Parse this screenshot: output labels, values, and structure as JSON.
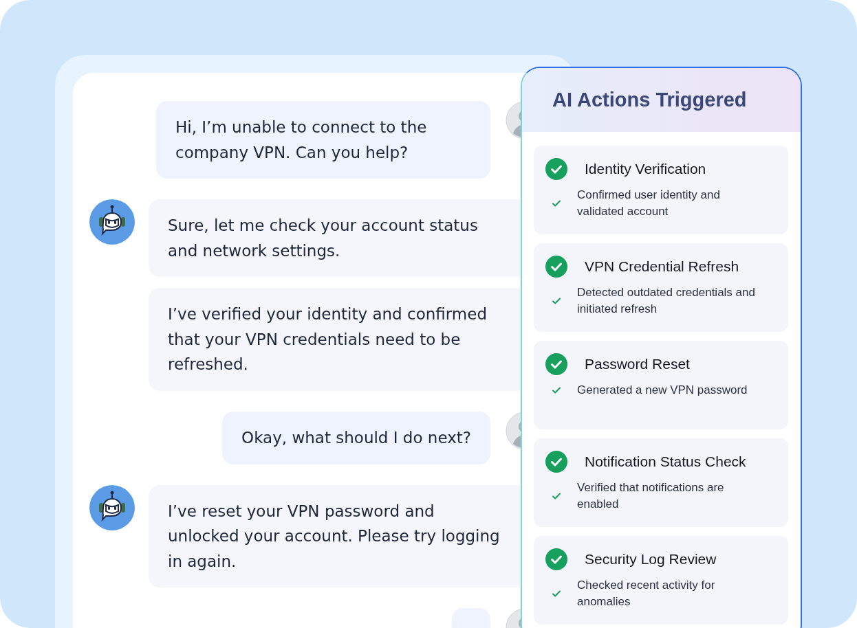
{
  "chat": {
    "messages": [
      {
        "kind": "user",
        "text": "Hi, I’m unable to connect to the company VPN. Can you help?"
      },
      {
        "kind": "bot",
        "text": "Sure, let me check your account status and network settings.",
        "first": true
      },
      {
        "kind": "bot",
        "text": "I’ve verified your identity and confirmed that your VPN credentials need to be refreshed.",
        "first": false
      },
      {
        "kind": "user",
        "text": "Okay, what should I do next?"
      },
      {
        "kind": "bot",
        "text": "I’ve reset your VPN password and unlocked your account. Please try logging in again.",
        "first": true
      },
      {
        "kind": "user"
      }
    ]
  },
  "actions_panel": {
    "title": "AI Actions Triggered",
    "actions": [
      {
        "title": "Identity Verification",
        "detail": "Confirmed user identity and validated account",
        "done": true
      },
      {
        "title": "VPN Credential Refresh",
        "detail": "Detected outdated credentials and initiated refresh",
        "done": true
      },
      {
        "title": "Password Reset",
        "detail": "Generated a new VPN password",
        "done": true
      },
      {
        "title": "Notification Status Check",
        "detail": "Verified that notifications are enabled",
        "done": true
      },
      {
        "title": "Security Log Review",
        "detail": "Checked recent activity for anomalies",
        "done": true
      }
    ]
  }
}
